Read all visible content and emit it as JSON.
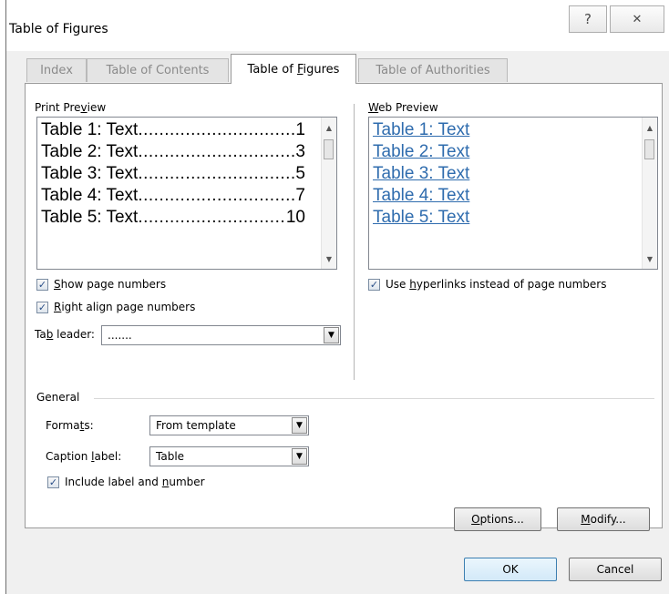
{
  "window": {
    "title": "Table of Figures",
    "help_glyph": "?",
    "close_glyph": "✕"
  },
  "tabs": [
    {
      "label": "Index",
      "active": false
    },
    {
      "label": "Table of Contents",
      "active": false
    },
    {
      "label": "Table of Figures",
      "active": true
    },
    {
      "label": "Table of Authorities",
      "active": false
    }
  ],
  "print_preview": {
    "label": "Print Preview",
    "entries": [
      {
        "text": "Table 1: Text",
        "dots": "......................................",
        "page": "1"
      },
      {
        "text": "Table 2: Text",
        "dots": "......................................",
        "page": "3"
      },
      {
        "text": "Table 3: Text",
        "dots": "......................................",
        "page": "5"
      },
      {
        "text": "Table 4: Text",
        "dots": "......................................",
        "page": "7"
      },
      {
        "text": "Table 5: Text",
        "dots": "......................................",
        "page": "10"
      }
    ]
  },
  "web_preview": {
    "label": "Web Preview",
    "entries": [
      "Table 1: Text",
      "Table 2: Text",
      "Table 3: Text",
      "Table 4: Text",
      "Table 5: Text"
    ]
  },
  "options": {
    "show_page_numbers": {
      "label": "Show page numbers",
      "checked": true
    },
    "right_align": {
      "label": "Right align page numbers",
      "checked": true
    },
    "use_hyperlinks": {
      "label": "Use hyperlinks instead of page numbers",
      "checked": true
    },
    "tab_leader": {
      "label": "Tab leader:",
      "value": "......."
    }
  },
  "general": {
    "label": "General",
    "formats": {
      "label": "Formats:",
      "value": "From template"
    },
    "caption_label": {
      "label": "Caption label:",
      "value": "Table"
    },
    "include_label": {
      "label": "Include label and number",
      "checked": true
    }
  },
  "buttons": {
    "options": "Options...",
    "modify": "Modify...",
    "ok": "OK",
    "cancel": "Cancel"
  },
  "colors": {
    "link": "#2f6cae",
    "accent_border": "#3c7fb1"
  }
}
